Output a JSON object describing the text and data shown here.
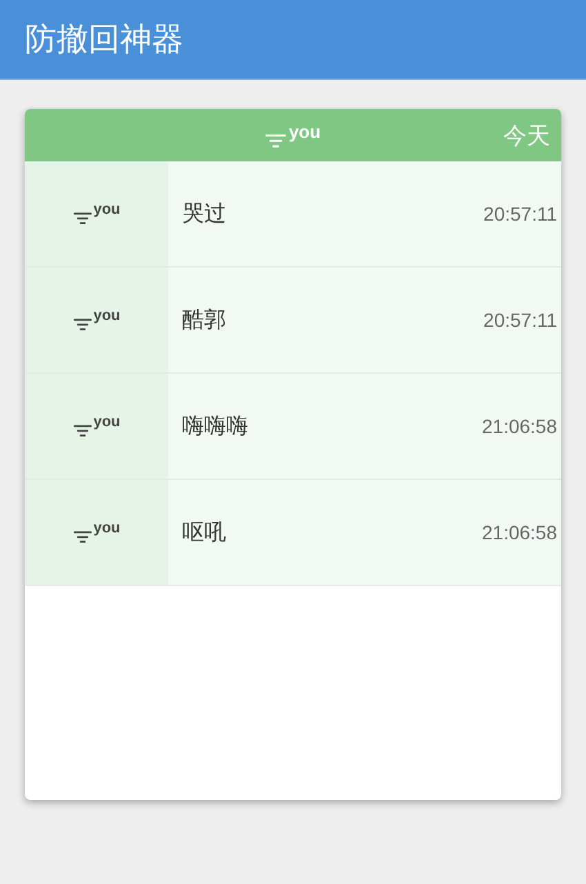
{
  "app_bar": {
    "title": "防撤回神器"
  },
  "card": {
    "header": {
      "sender": "you",
      "date": "今天"
    },
    "messages": [
      {
        "sender": "you",
        "text": "哭过",
        "time": "20:57:11"
      },
      {
        "sender": "you",
        "text": "酷郭",
        "time": "20:57:11"
      },
      {
        "sender": "you",
        "text": "嗨嗨嗨",
        "time": "21:06:58"
      },
      {
        "sender": "you",
        "text": "呕吼",
        "time": "21:06:58"
      }
    ]
  }
}
